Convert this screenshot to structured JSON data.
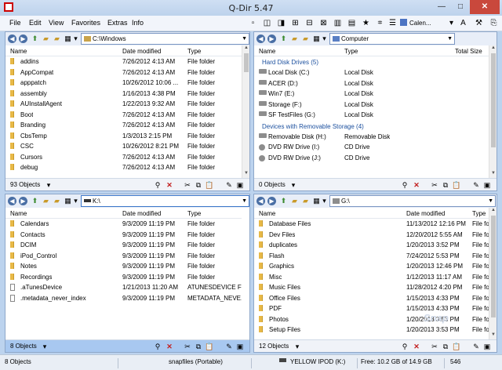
{
  "window": {
    "title": "Q-Dir 5.47",
    "min": "—",
    "max": "□",
    "close": "✕"
  },
  "menu": [
    "File",
    "Edit",
    "View",
    "Favorites",
    "Extras",
    "Info"
  ],
  "toolbar": {
    "calendar_label": "Calen..."
  },
  "panes": {
    "top_left": {
      "path": "C:\\Windows",
      "columns": [
        "Name",
        "Date modified",
        "Type"
      ],
      "rows": [
        {
          "name": "addins",
          "date": "7/26/2012 4:13 AM",
          "type": "File folder"
        },
        {
          "name": "AppCompat",
          "date": "7/26/2012 4:13 AM",
          "type": "File folder"
        },
        {
          "name": "apppatch",
          "date": "10/26/2012 10:06 ...",
          "type": "File folder"
        },
        {
          "name": "assembly",
          "date": "1/16/2013 4:38 PM",
          "type": "File folder"
        },
        {
          "name": "AUInstallAgent",
          "date": "1/22/2013 9:32 AM",
          "type": "File folder"
        },
        {
          "name": "Boot",
          "date": "7/26/2012 4:13 AM",
          "type": "File folder"
        },
        {
          "name": "Branding",
          "date": "7/26/2012 4:13 AM",
          "type": "File folder"
        },
        {
          "name": "CbsTemp",
          "date": "1/3/2013 2:15 PM",
          "type": "File folder"
        },
        {
          "name": "CSC",
          "date": "10/26/2012 8:21 PM",
          "type": "File folder"
        },
        {
          "name": "Cursors",
          "date": "7/26/2012 4:13 AM",
          "type": "File folder"
        },
        {
          "name": "debug",
          "date": "7/26/2012 4:13 AM",
          "type": "File folder"
        }
      ],
      "status": "93 Objects"
    },
    "top_right": {
      "path": "Computer",
      "columns": [
        "Name",
        "Type",
        "Total Size"
      ],
      "groups": [
        {
          "label": "Hard Disk Drives (5)",
          "rows": [
            {
              "name": "Local Disk (C:)",
              "type": "Local Disk"
            },
            {
              "name": "ACER (D:)",
              "type": "Local Disk"
            },
            {
              "name": "Win7 (E:)",
              "type": "Local Disk"
            },
            {
              "name": "Storage (F:)",
              "type": "Local Disk"
            },
            {
              "name": "SF TestFiles (G:)",
              "type": "Local Disk"
            }
          ]
        },
        {
          "label": "Devices with Removable Storage (4)",
          "rows": [
            {
              "name": "Removable Disk (H:)",
              "type": "Removable Disk"
            },
            {
              "name": "DVD RW Drive (I:)",
              "type": "CD Drive"
            },
            {
              "name": "DVD RW Drive (J:)",
              "type": "CD Drive"
            }
          ]
        }
      ],
      "status": "0 Objects"
    },
    "bottom_left": {
      "path": "K:\\",
      "columns": [
        "Name",
        "Date modified",
        "Type"
      ],
      "rows": [
        {
          "name": "Calendars",
          "date": "9/3/2009 11:19 PM",
          "type": "File folder",
          "icon": "folder"
        },
        {
          "name": "Contacts",
          "date": "9/3/2009 11:19 PM",
          "type": "File folder",
          "icon": "folder"
        },
        {
          "name": "DCIM",
          "date": "9/3/2009 11:19 PM",
          "type": "File folder",
          "icon": "folder"
        },
        {
          "name": "iPod_Control",
          "date": "9/3/2009 11:19 PM",
          "type": "File folder",
          "icon": "folder"
        },
        {
          "name": "Notes",
          "date": "9/3/2009 11:19 PM",
          "type": "File folder",
          "icon": "folder"
        },
        {
          "name": "Recordings",
          "date": "9/3/2009 11:19 PM",
          "type": "File folder",
          "icon": "folder"
        },
        {
          "name": ".aTunesDevice",
          "date": "1/21/2013 11:20 AM",
          "type": "ATUNESDEVICE File",
          "icon": "file"
        },
        {
          "name": ".metadata_never_index",
          "date": "9/3/2009 11:19 PM",
          "type": "METADATA_NEVE...",
          "icon": "file"
        }
      ],
      "status": "8 Objects"
    },
    "bottom_right": {
      "path": "G:\\",
      "columns": [
        "Name",
        "Date modified",
        "Type"
      ],
      "rows": [
        {
          "name": "Database Files",
          "date": "11/13/2012 12:16 PM",
          "type": "File fol"
        },
        {
          "name": "Dev Files",
          "date": "12/20/2012 5:55 AM",
          "type": "File fol"
        },
        {
          "name": "duplicates",
          "date": "1/20/2013 3:52 PM",
          "type": "File fol"
        },
        {
          "name": "Flash",
          "date": "7/24/2012 5:53 PM",
          "type": "File fol"
        },
        {
          "name": "Graphics",
          "date": "1/20/2013 12:46 PM",
          "type": "File fol"
        },
        {
          "name": "Misc",
          "date": "1/12/2013 11:17 AM",
          "type": "File fol"
        },
        {
          "name": "Music Files",
          "date": "11/28/2012 4:20 PM",
          "type": "File fol"
        },
        {
          "name": "Office Files",
          "date": "1/15/2013 4:33 PM",
          "type": "File fol"
        },
        {
          "name": "PDF",
          "date": "1/15/2013 4:33 PM",
          "type": "File fol"
        },
        {
          "name": "Photos",
          "date": "1/20/2013 3:53 PM",
          "type": "File fol"
        },
        {
          "name": "Setup Files",
          "date": "1/20/2013 3:53 PM",
          "type": "File fol"
        }
      ],
      "status": "12 Objects"
    }
  },
  "statusbar": {
    "objects": "8 Objects",
    "app": "snapfiles (Portable)",
    "device": "YELLOW IPOD (K:)",
    "free": "Free: 10.2 GB of 14.9 GB",
    "number": "546"
  },
  "watermark": "Snap",
  "colors": {
    "accent": "#a8c8f0",
    "folder": "#e8b947",
    "close": "#c9483c",
    "group": "#1b4f9e"
  }
}
